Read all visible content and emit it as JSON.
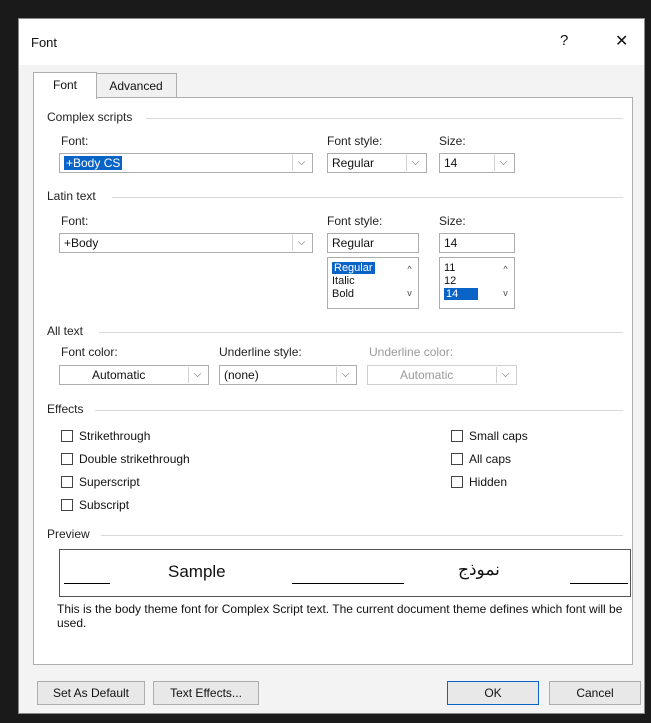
{
  "window": {
    "title": "Font",
    "help_glyph": "?",
    "close_glyph": "✕"
  },
  "tabs": [
    {
      "label": "Font"
    },
    {
      "label": "Advanced"
    }
  ],
  "complex": {
    "group": "Complex scripts",
    "font_label": "Font:",
    "font_value": "+Body CS",
    "style_label": "Font style:",
    "style_value": "Regular",
    "size_label": "Size:",
    "size_value": "14"
  },
  "latin": {
    "group": "Latin text",
    "font_label": "Font:",
    "font_value": "+Body",
    "style_label": "Font style:",
    "style_value": "Regular",
    "size_label": "Size:",
    "size_value": "14",
    "style_options": [
      "Regular",
      "Italic",
      "Bold"
    ],
    "style_selected": "Regular",
    "size_options": [
      "11",
      "12",
      "14"
    ],
    "size_selected": "14"
  },
  "all_text": {
    "group": "All text",
    "color_label": "Font color:",
    "color_value": "Automatic",
    "underline_style_label": "Underline style:",
    "underline_style_value": "(none)",
    "underline_color_label": "Underline color:",
    "underline_color_value": "Automatic"
  },
  "effects": {
    "group": "Effects",
    "strikethrough": "Strikethrough",
    "double_strikethrough": "Double strikethrough",
    "superscript": "Superscript",
    "subscript": "Subscript",
    "small_caps": "Small caps",
    "all_caps": "All caps",
    "hidden": "Hidden"
  },
  "preview": {
    "group": "Preview",
    "sample_latin": "Sample",
    "sample_arabic": "نموذج",
    "note": "This is the body theme font for Complex Script text. The current document theme defines which font will be used."
  },
  "buttons": {
    "set_default": "Set As Default",
    "text_effects": "Text Effects...",
    "ok": "OK",
    "cancel": "Cancel"
  },
  "glyphs": {
    "dropdown": "⌵",
    "up": "^",
    "down": "v"
  }
}
